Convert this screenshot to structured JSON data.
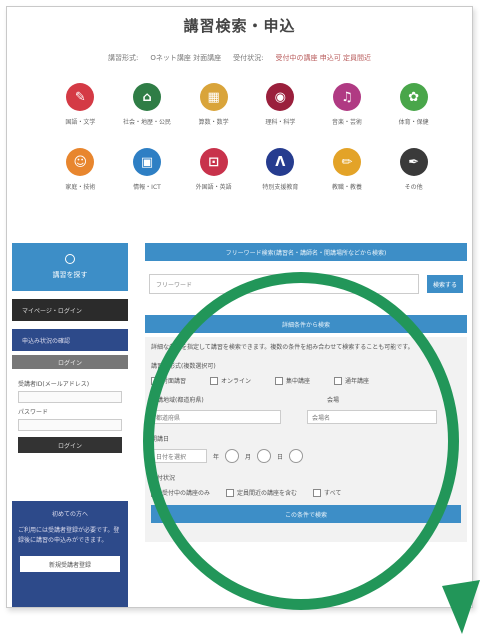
{
  "page": {
    "title": "講習検索・申込"
  },
  "subnav": [
    {
      "text": "講習形式:",
      "highlight": false
    },
    {
      "text": "Oネット講座 対面講座",
      "highlight": false
    },
    {
      "text": "受付状況:",
      "highlight": false
    },
    {
      "text": "受付中の講座 申込可 定員間近",
      "highlight": true
    }
  ],
  "icons": [
    {
      "name": "category-1-icon",
      "color": "#d43a45",
      "glyph": "✎",
      "label": "国語・文学"
    },
    {
      "name": "category-2-icon",
      "color": "#2f7d46",
      "glyph": "⌂",
      "label": "社会・地歴・公民"
    },
    {
      "name": "category-3-icon",
      "color": "#d9a43a",
      "glyph": "▦",
      "label": "算数・数学"
    },
    {
      "name": "category-4-icon",
      "color": "#9a1f3c",
      "glyph": "◉",
      "label": "理科・科学"
    },
    {
      "name": "category-5-icon",
      "color": "#b03a83",
      "glyph": "♫",
      "label": "音楽・芸術"
    },
    {
      "name": "category-6-icon",
      "color": "#49a64a",
      "glyph": "✿",
      "label": "体育・保健"
    },
    {
      "name": "category-7-icon",
      "color": "#e8862e",
      "glyph": "☺",
      "label": "家庭・技術"
    },
    {
      "name": "category-8-icon",
      "color": "#2e7fc4",
      "glyph": "▣",
      "label": "情報・ICT"
    },
    {
      "name": "category-9-icon",
      "color": "#c8324b",
      "glyph": "⊡",
      "label": "外国語・英語"
    },
    {
      "name": "category-10-icon",
      "color": "#263c8f",
      "glyph": "Λ",
      "label": "特別支援教育"
    },
    {
      "name": "category-11-icon",
      "color": "#e3a328",
      "glyph": "✏",
      "label": "教職・教養"
    },
    {
      "name": "category-12-icon",
      "color": "#3a3a3a",
      "glyph": "✒",
      "label": "その他"
    }
  ],
  "sidebar": {
    "top_label": "講習を探す",
    "dark_item": "マイページ・ログイン",
    "navy_item": "申込み状況の確認",
    "grey_item": "ログイン",
    "form": {
      "id_label": "受講者ID(メールアドレス)",
      "pw_label": "パスワード",
      "submit": "ログイン"
    },
    "box": {
      "heading": "初めての方へ",
      "text": "ご利用には受講者登録が必要です。登録後に講習の申込みができます。",
      "button": "新規受講者登録"
    }
  },
  "main": {
    "keyword_bar": "フリーワード検索(講習名・講師名・開講場所などから検索)",
    "search_placeholder": "フリーワード",
    "search_button": "検索する",
    "detail_bar": "詳細条件から検索",
    "detail_desc": "詳細な条件を指定して講習を検索できます。複数の条件を組み合わせて検索することも可能です。",
    "form_row1_label": "講習の形式(複数選択可)",
    "checkboxes": [
      "対面講習",
      "オンライン",
      "集中講座",
      "通年講座"
    ],
    "area_label": "開講地域(都道府県)",
    "area_label2": "会場",
    "area_placeholder": "都道府県",
    "venue_placeholder": "会場名",
    "date_label": "開講日",
    "date_hint": "日付を選択",
    "date_units": [
      "年",
      "月",
      "日"
    ],
    "option_label": "受付状況",
    "options": [
      "受付中の講座のみ",
      "定員間近の講座を含む",
      "すべて"
    ],
    "submit": "この条件で検索"
  },
  "colors": {
    "accent_blue": "#3d8ec7",
    "navy": "#2d4a8a",
    "highlight_green": "#229659"
  }
}
